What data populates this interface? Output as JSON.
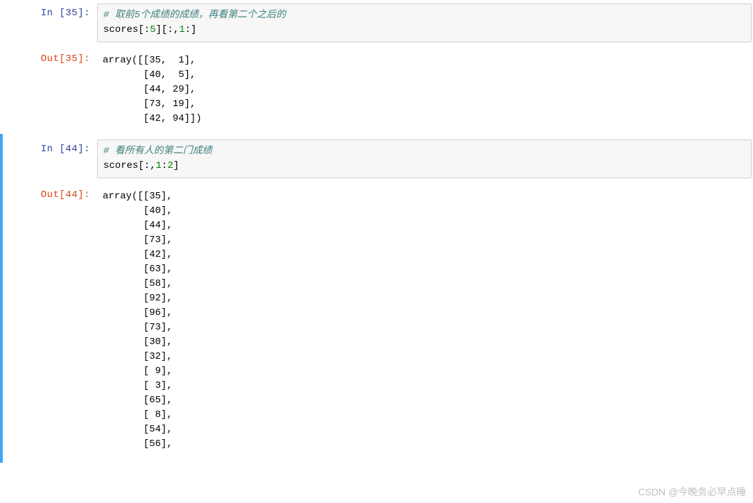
{
  "cells": [
    {
      "type": "code",
      "execution_count": 35,
      "in_label": "In  [35]:",
      "comment": "# 取前5个成绩的成绩，再看第二个之后的",
      "code_prefix": "scores[:",
      "code_num1": "5",
      "code_mid": "][:,",
      "code_num2": "1",
      "code_suffix": ":]"
    },
    {
      "type": "output",
      "out_label": "Out[35]:",
      "text": "array([[35,  1],\n       [40,  5],\n       [44, 29],\n       [73, 19],\n       [42, 94]])"
    },
    {
      "type": "code",
      "active": true,
      "execution_count": 44,
      "in_label": "In  [44]:",
      "comment": "# 看所有人的第二门成绩",
      "code_prefix": "scores[:,",
      "code_num1": "1",
      "code_mid": ":",
      "code_num2": "2",
      "code_suffix": "]"
    },
    {
      "type": "output",
      "active": true,
      "out_label": "Out[44]:",
      "text": "array([[35],\n       [40],\n       [44],\n       [73],\n       [42],\n       [63],\n       [58],\n       [92],\n       [96],\n       [73],\n       [30],\n       [32],\n       [ 9],\n       [ 3],\n       [65],\n       [ 8],\n       [54],\n       [56],"
    }
  ],
  "watermark": "CSDN @今晚务必早点睡"
}
